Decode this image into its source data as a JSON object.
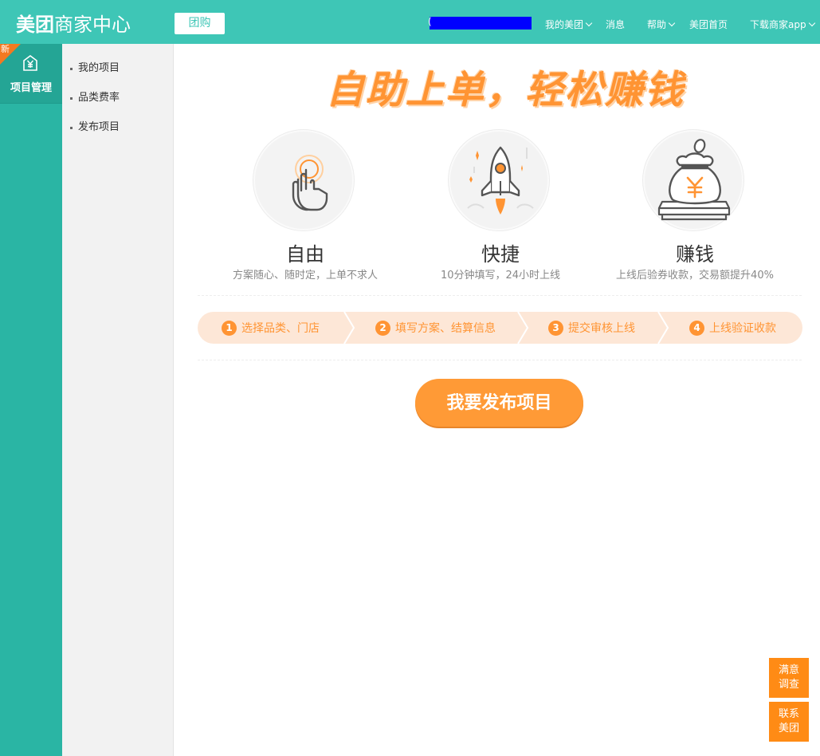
{
  "header": {
    "logo_brand": "美团",
    "logo_sub": "商家中心",
    "biz_button": "团购",
    "user_paren": "(",
    "nav": {
      "my_meituan": "我的美团",
      "messages": "消息",
      "help": "帮助",
      "home": "美团首页",
      "download": "下载商家app"
    }
  },
  "rail": {
    "badge": "新",
    "icon": "yen-house-icon",
    "label": "项目管理"
  },
  "submenu": {
    "items": [
      "我的项目",
      "品类费率",
      "发布项目"
    ]
  },
  "main": {
    "hero_title": "自助上单，轻松赚钱",
    "features": [
      {
        "icon": "hand-touch-icon",
        "title": "自由",
        "desc": "方案随心、随时定，上单不求人"
      },
      {
        "icon": "rocket-icon",
        "title": "快捷",
        "desc": "10分钟填写，24小时上线"
      },
      {
        "icon": "money-bag-icon",
        "title": "赚钱",
        "desc": "上线后验券收款，交易额提升40%"
      }
    ],
    "steps": [
      {
        "num": "1",
        "label": "选择品类、门店"
      },
      {
        "num": "2",
        "label": "填写方案、结算信息"
      },
      {
        "num": "3",
        "label": "提交审核上线"
      },
      {
        "num": "4",
        "label": "上线验证收款"
      }
    ],
    "publish_button": "我要发布项目"
  },
  "float": {
    "survey": [
      "满意",
      "调查"
    ],
    "contact": [
      "联系",
      "美团"
    ]
  },
  "colors": {
    "header_teal": "#3ec6b6",
    "rail_teal": "#2ab5a4",
    "accent_orange": "#ff9433",
    "float_orange": "#ff8b15",
    "user_mask": "#0000ff"
  }
}
